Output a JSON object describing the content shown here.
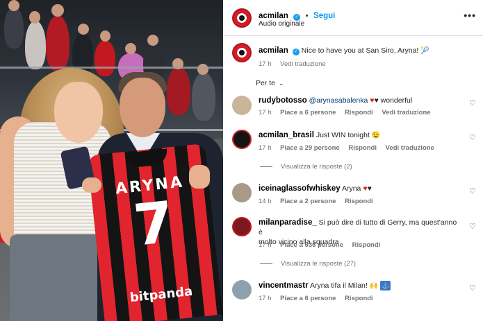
{
  "post": {
    "image_jersey_name": "ARYNA",
    "image_jersey_number": "7",
    "image_jersey_sponsor": "bitpanda"
  },
  "header": {
    "username": "acmilan",
    "follow_label": "Segui",
    "audio": "Audio originale",
    "more_icon": "more-icon"
  },
  "caption": {
    "username": "acmilan",
    "text": "Nice to have you at San Siro, Aryna!",
    "emoji": "🎾",
    "time": "17 h",
    "translate": "Vedi traduzione"
  },
  "filter_label": "Per te",
  "comments": [
    {
      "username": "rudybotosso",
      "mention": "@arynasabalenka",
      "text": "wonderful",
      "hearts": [
        "♥",
        "♥"
      ],
      "time": "17 h",
      "likes": "Piace a 6 persone",
      "reply": "Rispondi",
      "translate": "Vedi traduzione"
    },
    {
      "username": "acmilan_brasil",
      "text": "Just WIN tonight",
      "emoji": "😉",
      "time": "17 h",
      "likes": "Piace a 29 persone",
      "reply": "Rispondi",
      "translate": "Vedi traduzione",
      "view_replies": "Visualizza le risposte (2)"
    },
    {
      "username": "iceinaglassofwhiskey",
      "text": "Aryna",
      "hearts": [
        "♥",
        "♥"
      ],
      "time": "14 h",
      "likes": "Piace a 2 persone",
      "reply": "Rispondi"
    },
    {
      "username": "milanparadise_",
      "text_line1": "Si può dire di tutto di Gerry, ma quest'anno è",
      "text_line2": "molto vicino alla squadra",
      "time": "17 h",
      "likes": "Piace a 636 persone",
      "reply": "Rispondi",
      "view_replies": "Visualizza le risposte (27)"
    },
    {
      "username": "vincentmastr",
      "text": "Aryna tifa il Milan!",
      "emoji": "🙌",
      "badge": "⚓",
      "time": "17 h",
      "likes": "Piace a 6 persone",
      "reply": "Rispondi"
    }
  ],
  "colors": {
    "link_blue": "#0095f6",
    "verified_blue": "#1d9bf0",
    "muted_gray": "#737373",
    "milan_red": "#d11f2a"
  }
}
